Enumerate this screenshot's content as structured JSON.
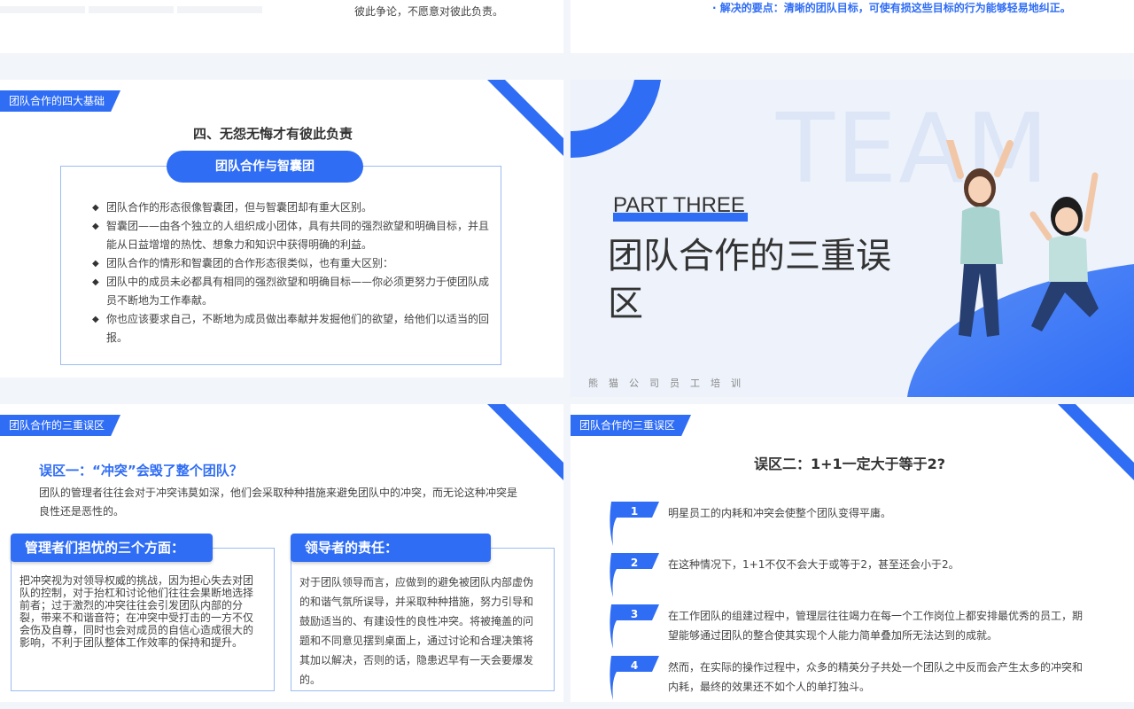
{
  "top_left": {
    "text": "彼此争论，不愿意对彼此负责。"
  },
  "top_right": {
    "bullet": "·  解决的要点：清晰的团队目标，可使有损这些目标的行为能够轻易地纠正。"
  },
  "slide1": {
    "tag": "团队合作的四大基础",
    "title": "四、无怨无悔才有彼此负责",
    "pill": "团队合作与智囊团",
    "bullets": [
      "团队合作的形态很像智囊团，但与智囊团却有重大区别。",
      "智囊团——由各个独立的人组织成小团体，具有共同的强烈欲望和明确目标，并且能从日益增增的热忱、想象力和知识中获得明确的利益。",
      "团队合作的情形和智囊团的合作形态很类似，也有重大区别：",
      "团队中的成员未必都具有相同的强烈欲望和明确目标——你必须更努力于使团队成员不断地为工作奉献。",
      "你也应该要求自己，不断地为成员做出奉献并发掘他们的欲望，给他们以适当的回报。"
    ]
  },
  "slide2": {
    "bg_word": "TEAM",
    "part": "PART THREE",
    "title": "团队合作的三重误区",
    "company": "熊猫公司员工培训"
  },
  "slide3": {
    "tag": "团队合作的三重误区",
    "heading": "误区一：“冲突”会毁了整个团队？",
    "intro": "团队的管理者往往会对于冲突讳莫如深，他们会采取种种措施来避免团队中的冲突，而无论这种冲突是良性还是恶性的。",
    "left_header": "管理者们担忧的三个方面：",
    "left_text": "把冲突视为对领导权威的挑战，因为担心失去对团队的控制，对于抬杠和讨论他们往往会果断地选择前者；过于激烈的冲突往往会引发团队内部的分裂，带来不和谐音符；在冲突中受打击的一方不仅会伤及自尊，同时也会对成员的自信心造成很大的影响，不利于团队整体工作效率的保持和提升。",
    "right_header": "领导者的责任：",
    "right_text": "对于团队领导而言，应做到的避免被团队内部虚伪的和谐气氛所误导，并采取种种措施，努力引导和鼓励适当的、有建设性的良性冲突。将被掩盖的问题和不同意见摆到桌面上，通过讨论和合理决策将其加以解决，否则的话，隐患迟早有一天会要爆发的。"
  },
  "slide4": {
    "tag": "团队合作的三重误区",
    "title": "误区二：1+1一定大于等于2?",
    "items": [
      {
        "num": "1",
        "text": "明星员工的内耗和冲突会使整个团队变得平庸。"
      },
      {
        "num": "2",
        "text": "在这种情况下，1+1不仅不会大于或等于2，甚至还会小于2。"
      },
      {
        "num": "3",
        "text": "在工作团队的组建过程中，管理层往往竭力在每一个工作岗位上都安排最优秀的员工，期望能够通过团队的整合使其实现个人能力简单叠加所无法达到的成就。"
      },
      {
        "num": "4",
        "text": "然而，在实际的操作过程中，众多的精英分子共处一个团队之中反而会产生太多的冲突和内耗，最终的效果还不如个人的单打独斗。"
      }
    ]
  },
  "colors": {
    "accent": "#2f6df5",
    "border": "#9bbcf2"
  }
}
